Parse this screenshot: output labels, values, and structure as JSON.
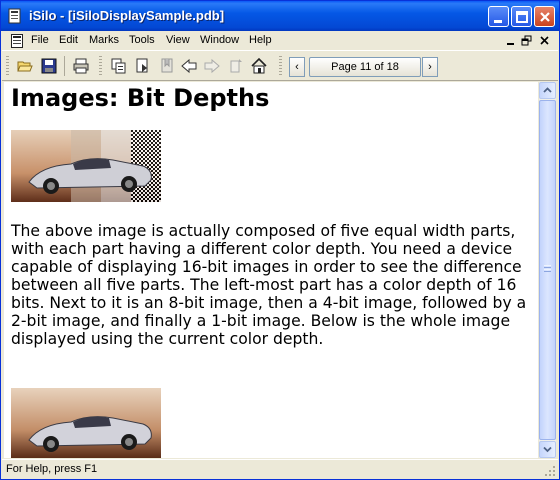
{
  "window": {
    "title": "iSilo - [iSiloDisplaySample.pdb]"
  },
  "menu": {
    "items": [
      "File",
      "Edit",
      "Marks",
      "Tools",
      "View",
      "Window",
      "Help"
    ]
  },
  "toolbar": {
    "page_indicator": "Page 11 of 18",
    "prev_label": "‹",
    "next_label": "›"
  },
  "content": {
    "heading": "Images: Bit Depths",
    "paragraph": "The above image is actually composed of five equal width parts, with each part having a different color depth. You need a device capable of displaying 16-bit images in order to see the difference between all five parts. The left-most part has a color depth of 16 bits. Next to it is an 8-bit image, then a 4-bit image, followed by a 2-bit image, and finally a 1-bit image. Below is the whole image displayed using the current color depth."
  },
  "status": {
    "text": "For Help, press F1"
  },
  "colors": {
    "titlebar": "#0558E6",
    "chrome": "#ECE9D8",
    "close": "#C9421E"
  }
}
